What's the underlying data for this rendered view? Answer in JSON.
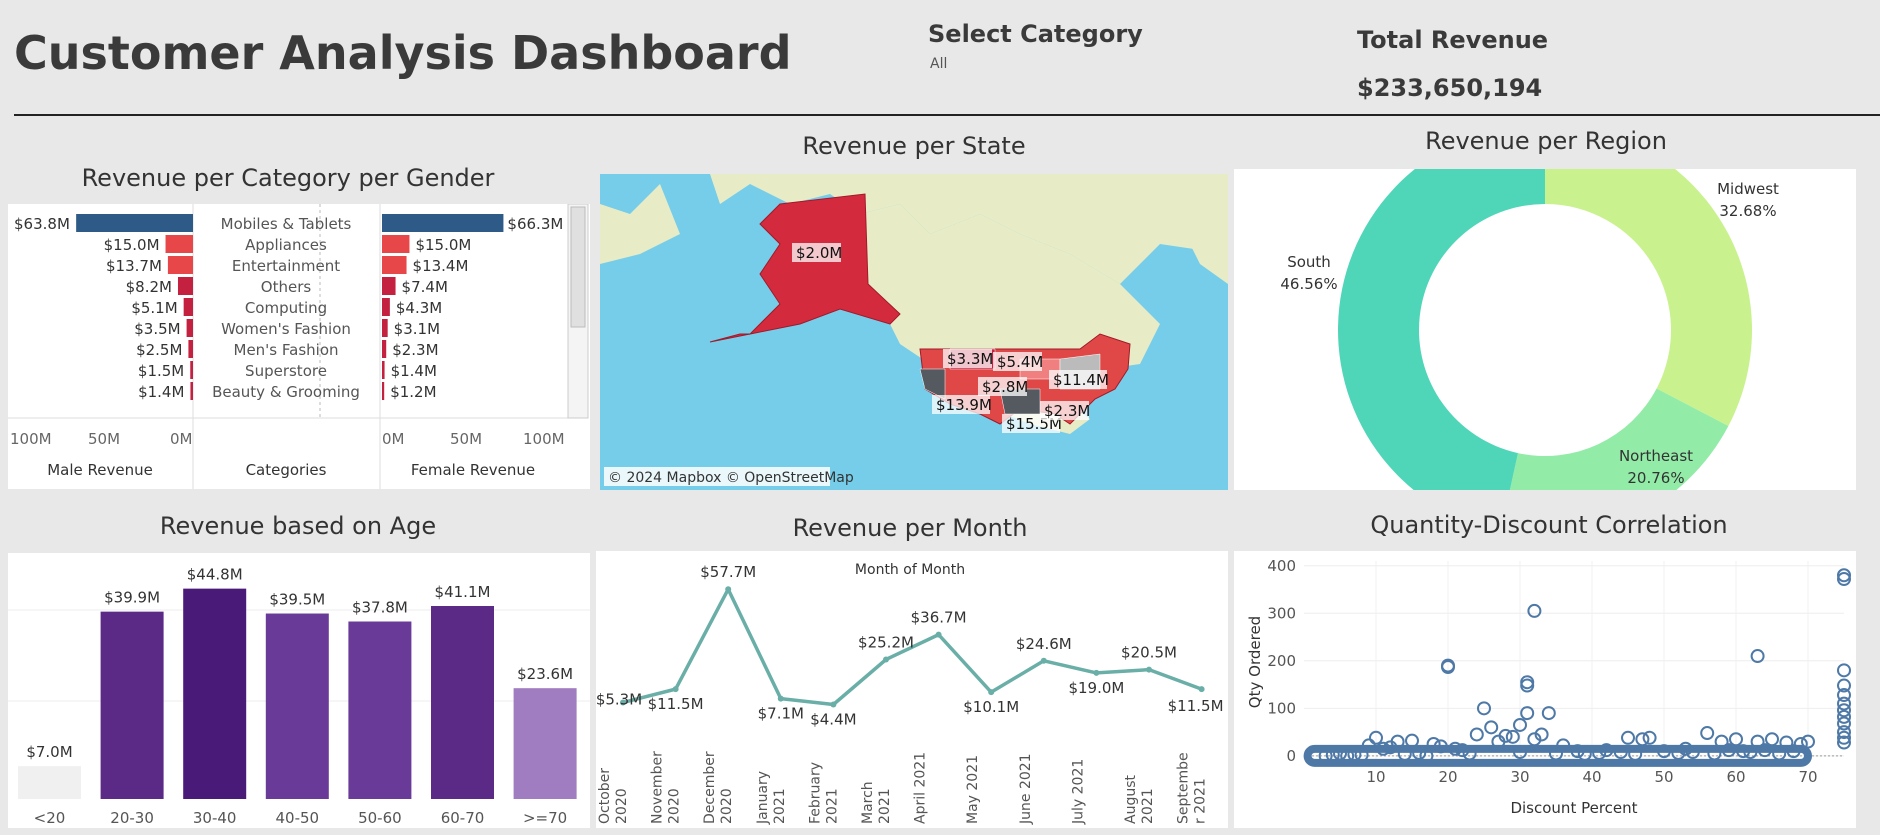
{
  "header": {
    "title": "Customer Analysis Dashboard",
    "filter_label": "Select Category",
    "filter_value": "All",
    "kpi_label": "Total Revenue",
    "kpi_value": "$233,650,194"
  },
  "titles": {
    "gender": "Revenue per Category per Gender",
    "state": "Revenue per State",
    "region": "Revenue per Region",
    "age": "Revenue based on Age",
    "month": "Revenue per Month",
    "scatter": "Quantity-Discount Correlation"
  },
  "colors": {
    "male_bar": "#2e5a87",
    "female_bar": "#2e5a87",
    "small_bar": "#e8474a",
    "dark_red": "#c42040",
    "region_south": "#4fd6b8",
    "region_midwest": "#c9f28f",
    "region_northeast": "#92eca7",
    "age_dark": "#5b2a87",
    "age_light": "#a07cc0",
    "line": "#6aaea8",
    "scatter": "#4e79a7"
  },
  "map": {
    "attribution": "© 2024 Mapbox © OpenStreetMap",
    "labels": [
      "$2.0M",
      "$3.3M",
      "$5.4M",
      "$2.8M",
      "$11.4M",
      "$13.9M",
      "$15.5M",
      "$2.3M"
    ]
  },
  "chart_data": [
    {
      "type": "bar",
      "title": "Revenue per Category per Gender",
      "categories": [
        "Mobiles & Tablets",
        "Appliances",
        "Entertainment",
        "Others",
        "Computing",
        "Women's Fashion",
        "Men's Fashion",
        "Superstore",
        "Beauty & Grooming"
      ],
      "series": [
        {
          "name": "Male Revenue",
          "values": [
            63.8,
            15.0,
            13.7,
            8.2,
            5.1,
            3.5,
            2.5,
            1.5,
            1.4
          ],
          "labels": [
            "$63.8M",
            "$15.0M",
            "$13.7M",
            "$8.2M",
            "$5.1M",
            "$3.5M",
            "$2.5M",
            "$1.5M",
            "$1.4M"
          ]
        },
        {
          "name": "Female Revenue",
          "values": [
            66.3,
            15.0,
            13.4,
            7.4,
            4.3,
            3.1,
            2.3,
            1.4,
            1.2
          ],
          "labels": [
            "$66.3M",
            "$15.0M",
            "$13.4M",
            "$7.4M",
            "$4.3M",
            "$3.1M",
            "$2.3M",
            "$1.4M",
            "$1.2M"
          ]
        }
      ],
      "male_ticks": [
        "100M",
        "50M",
        "0M"
      ],
      "female_ticks": [
        "0M",
        "50M",
        "100M"
      ],
      "xlabel_male": "Male Revenue",
      "xlabel_cat": "Categories",
      "xlabel_female": "Female Revenue",
      "xlim": [
        0,
        100
      ]
    },
    {
      "type": "pie",
      "title": "Revenue per Region",
      "categories": [
        "Midwest",
        "Northeast",
        "South"
      ],
      "values": [
        32.68,
        20.76,
        46.56
      ],
      "labels": [
        "32.68%",
        "20.76%",
        "46.56%"
      ]
    },
    {
      "type": "bar",
      "title": "Revenue based on Age",
      "categories": [
        "<20",
        "20-30",
        "30-40",
        "40-50",
        "50-60",
        "60-70",
        ">=70"
      ],
      "values": [
        7.0,
        39.9,
        44.8,
        39.5,
        37.8,
        41.1,
        23.6
      ],
      "labels": [
        "$7.0M",
        "$39.9M",
        "$44.8M",
        "$39.5M",
        "$37.8M",
        "$41.1M",
        "$23.6M"
      ],
      "ylim": [
        0,
        46
      ]
    },
    {
      "type": "line",
      "title": "Revenue per Month",
      "subtitle": "Month of Month",
      "categories": [
        "October 2020",
        "November 2020",
        "December 2020",
        "January 2021",
        "February 2021",
        "March 2021",
        "April 2021",
        "May 2021",
        "June 2021",
        "July 2021",
        "August 2021",
        "September 2021"
      ],
      "tick_labels": [
        [
          "October",
          "2020"
        ],
        [
          "November",
          "2020"
        ],
        [
          "December",
          "2020"
        ],
        [
          "January",
          "2021"
        ],
        [
          "February",
          "2021"
        ],
        [
          "March",
          "2021"
        ],
        [
          "April 2021"
        ],
        [
          "May 2021"
        ],
        [
          "June 2021"
        ],
        [
          "July 2021"
        ],
        [
          "August",
          "2021"
        ],
        [
          "Septembe",
          "r 2021"
        ]
      ],
      "values": [
        5.3,
        11.5,
        57.7,
        7.1,
        4.4,
        25.2,
        36.7,
        10.1,
        24.6,
        19.0,
        20.5,
        11.5
      ],
      "labels": [
        "$5.3M",
        "$11.5M",
        "$57.7M",
        "$7.1M",
        "$4.4M",
        "$25.2M",
        "$36.7M",
        "$10.1M",
        "$24.6M",
        "$19.0M",
        "$20.5M",
        "$11.5M"
      ],
      "ylim": [
        0,
        60
      ]
    },
    {
      "type": "scatter",
      "title": "Quantity-Discount Correlation",
      "xlabel": "Discount Percent",
      "ylabel": "Qty Ordered",
      "xlim": [
        0,
        75
      ],
      "ylim": [
        -15,
        410
      ],
      "xticks": [
        10,
        20,
        30,
        40,
        50,
        60,
        70
      ],
      "yticks": [
        0,
        100,
        200,
        300,
        400
      ],
      "points": [
        [
          20,
          190
        ],
        [
          20,
          187
        ],
        [
          32,
          305
        ],
        [
          31,
          155
        ],
        [
          31,
          148
        ],
        [
          63,
          210
        ],
        [
          75,
          380
        ],
        [
          75,
          372
        ],
        [
          75,
          180
        ],
        [
          75,
          148
        ],
        [
          75,
          128
        ],
        [
          75,
          110
        ],
        [
          75,
          96
        ],
        [
          75,
          82
        ],
        [
          75,
          68
        ],
        [
          75,
          50
        ],
        [
          75,
          38
        ],
        [
          75,
          28
        ],
        [
          25,
          100
        ],
        [
          31,
          90
        ],
        [
          34,
          90
        ],
        [
          30,
          65
        ],
        [
          26,
          60
        ],
        [
          24,
          45
        ],
        [
          28,
          42
        ],
        [
          29,
          40
        ],
        [
          33,
          45
        ],
        [
          32,
          35
        ],
        [
          27,
          30
        ],
        [
          10,
          38
        ],
        [
          13,
          30
        ],
        [
          15,
          32
        ],
        [
          9,
          22
        ],
        [
          12,
          18
        ],
        [
          11,
          15
        ],
        [
          21,
          15
        ],
        [
          18,
          25
        ],
        [
          19,
          20
        ],
        [
          22,
          12
        ],
        [
          36,
          22
        ],
        [
          45,
          38
        ],
        [
          47,
          35
        ],
        [
          48,
          38
        ],
        [
          56,
          48
        ],
        [
          58,
          30
        ],
        [
          60,
          35
        ],
        [
          63,
          30
        ],
        [
          65,
          35
        ],
        [
          67,
          28
        ],
        [
          70,
          30
        ],
        [
          69,
          25
        ],
        [
          5,
          5
        ],
        [
          6,
          0
        ],
        [
          7,
          3
        ],
        [
          8,
          2
        ],
        [
          14,
          4
        ],
        [
          16,
          6
        ],
        [
          17,
          0
        ],
        [
          23,
          5
        ],
        [
          30,
          8
        ],
        [
          35,
          5
        ],
        [
          38,
          10
        ],
        [
          41,
          6
        ],
        [
          44,
          8
        ],
        [
          46,
          4
        ],
        [
          50,
          10
        ],
        [
          52,
          6
        ],
        [
          54,
          8
        ],
        [
          57,
          5
        ],
        [
          59,
          12
        ],
        [
          61,
          10
        ],
        [
          62,
          8
        ],
        [
          64,
          12
        ],
        [
          66,
          5
        ],
        [
          68,
          10
        ],
        [
          3,
          0
        ],
        [
          4,
          2
        ],
        [
          39,
          4
        ],
        [
          42,
          12
        ],
        [
          53,
          15
        ]
      ]
    }
  ]
}
